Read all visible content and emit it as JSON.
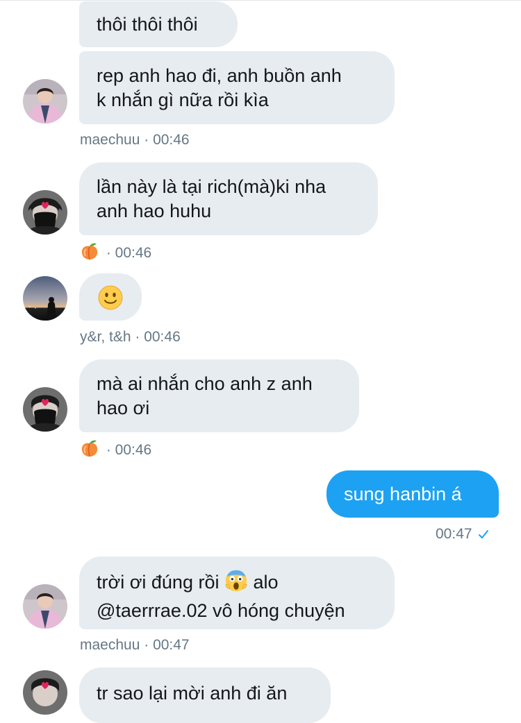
{
  "conversation": {
    "messages": [
      {
        "lines": [
          "thôi thôi thôi"
        ]
      },
      {
        "lines": [
          "rep anh hao đi, anh buồn anh",
          "k nhắn gì nữa rồi kìa"
        ]
      },
      {
        "lines": [
          "lần này là tại rich(mà)ki nha",
          "anh hao huhu"
        ]
      },
      {
        "emoji": "slightly-smiling-face"
      },
      {
        "lines": [
          "mà ai nhắn cho anh z anh",
          "hao ơi"
        ]
      },
      {
        "lines": [
          "sung hanbin á"
        ]
      },
      {
        "line1_before": "trời ơi đúng rồi",
        "line1_emoji": "face-screaming-in-fear",
        "line1_after": "alo",
        "line2": "@taerrrae.02 vô hóng chuyện"
      },
      {
        "lines": [
          "tr sao lại mời anh đi ăn"
        ]
      }
    ],
    "meta": [
      {
        "sender": "maechuu",
        "separator": " · ",
        "time": "00:46"
      },
      {
        "sender_icon": "peach-emoji",
        "separator": " · ",
        "time": "00:46"
      },
      {
        "sender": "y&r, t&h",
        "separator": " · ",
        "time": "00:46"
      },
      {
        "sender_icon": "peach-emoji",
        "separator": " · ",
        "time": "00:46"
      },
      {
        "time": "00:47",
        "status_icon": "checkmark-icon"
      },
      {
        "sender": "maechuu",
        "separator": " · ",
        "time": "00:47"
      }
    ],
    "avatars": [
      {
        "user": "maechuu",
        "icon": "avatar-pink-jacket"
      },
      {
        "user": "peach",
        "icon": "avatar-black-mask"
      },
      {
        "user": "y&r, t&h",
        "icon": "avatar-night-sky"
      },
      {
        "user": "peach",
        "icon": "avatar-black-mask"
      },
      {
        "user": "maechuu",
        "icon": "avatar-pink-jacket"
      },
      {
        "user": "peach",
        "icon": "avatar-black-mask"
      }
    ]
  },
  "colors": {
    "received_bubble": "#e6ecf0",
    "sent_bubble": "#1da1f2",
    "meta_text": "#657786",
    "check": "#1da1f2"
  }
}
